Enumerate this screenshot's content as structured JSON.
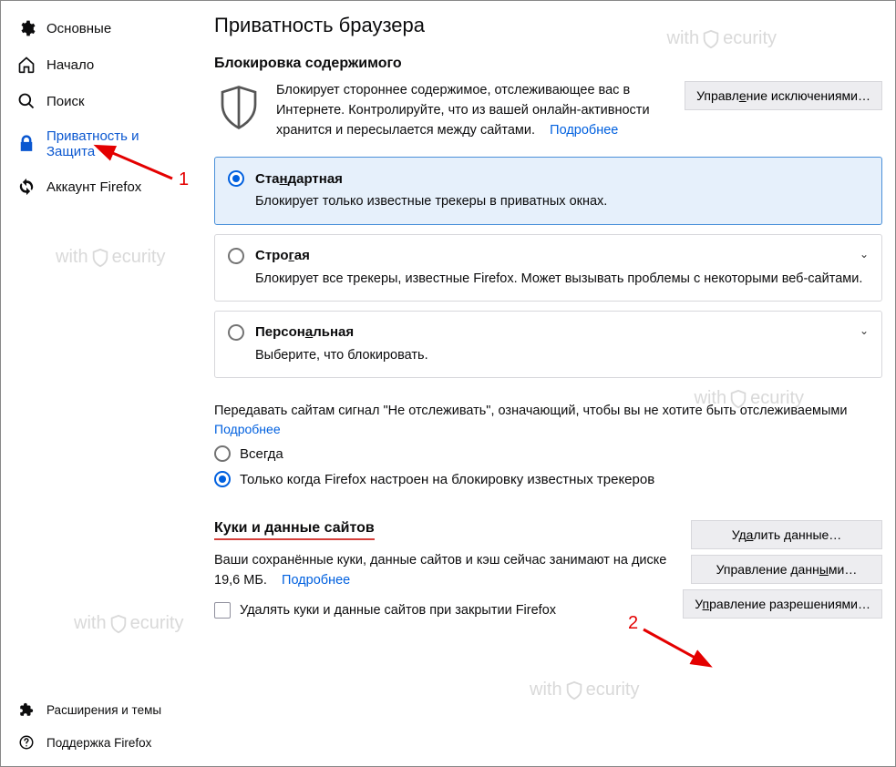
{
  "sidebar": {
    "items": [
      {
        "label": "Основные"
      },
      {
        "label": "Начало"
      },
      {
        "label": "Поиск"
      },
      {
        "label": "Приватность и Защита"
      },
      {
        "label": "Аккаунт Firefox"
      }
    ],
    "footer": [
      {
        "label": "Расширения и темы"
      },
      {
        "label": "Поддержка Firefox"
      }
    ]
  },
  "page": {
    "title": "Приватность браузера",
    "block_heading": "Блокировка содержимого",
    "block_desc": "Блокирует стороннее содержимое, отслеживающее вас в Интернете. Контролируйте, что из вашей онлайн-активности хранится и пересылается между сайтами.",
    "learn_more": "Подробнее",
    "exceptions_btn": "Управление исключениями…",
    "options": [
      {
        "title": "Стандартная",
        "desc": "Блокирует только известные трекеры в приватных окнах."
      },
      {
        "title": "Строгая",
        "desc": "Блокирует все трекеры, известные Firefox. Может вызывать проблемы с некоторыми веб-сайтами."
      },
      {
        "title": "Персональная",
        "desc": "Выберите, что блокировать."
      }
    ],
    "dnt_text": "Передавать сайтам сигнал \"Не отслеживать\", означающий, чтобы вы не хотите быть отслеживаемыми",
    "dnt_more": "Подробнее",
    "dnt_opts": [
      {
        "label": "Всегда"
      },
      {
        "label": "Только когда Firefox настроен на блокировку известных трекеров"
      }
    ],
    "cookies_heading": "Куки и данные сайтов",
    "cookies_desc_pre": "Ваши сохранённые куки, данные сайтов и кэш сейчас занимают на диске ",
    "cookies_size": "19,6 МБ",
    "cookies_desc_post": ".",
    "cookies_more": "Подробнее",
    "cookies_buttons": {
      "clear": "Удалить данные…",
      "manage": "Управление данными…",
      "perms": "Управление разрешениями…"
    },
    "cookies_checkbox": "Удалять куки и данные сайтов при закрытии Firefox"
  },
  "watermark": "withSecurity",
  "annotations": {
    "one": "1",
    "two": "2"
  }
}
